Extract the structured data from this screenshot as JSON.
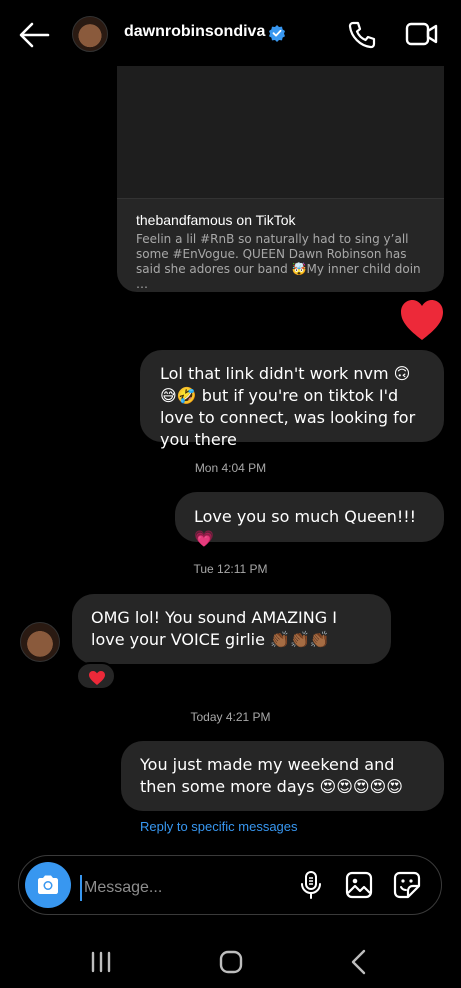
{
  "header": {
    "username": "dawnrobinsondiva"
  },
  "shared_post": {
    "title": "thebandfamous on TikTok",
    "description": "Feelin a lil #RnB so naturally had to sing y’all some #EnVogue. QUEEN Dawn Robinson has said she adores our band 🤯My inner child doin …"
  },
  "messages": [
    {
      "text": "Lol that link didn't work nvm 🙃😅🤣 but if you're on tiktok I'd love to connect, was looking for you there"
    },
    {
      "text": "Love you so much Queen!!! 💗"
    },
    {
      "text": "OMG lol! You sound AMAZING I love your VOICE girlie 👏🏾👏🏾👏🏾"
    },
    {
      "text": "You just made my weekend and then some more days 😍😍😍😍😍"
    }
  ],
  "timestamps": [
    "Mon 4:04 PM",
    "Tue 12:11 PM",
    "Today 4:21 PM"
  ],
  "reply_hint": "Reply to specific messages",
  "composer": {
    "placeholder": "Message..."
  },
  "colors": {
    "accent": "#3897f0",
    "bubble": "#262626",
    "heart": "#ed2939",
    "background": "#000000"
  }
}
